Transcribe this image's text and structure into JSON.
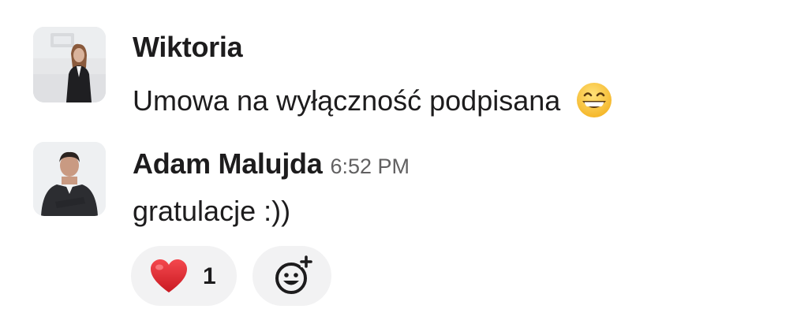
{
  "messages": [
    {
      "author": "Wiktoria",
      "time": "",
      "text": "Umowa na wyłączność podpisana",
      "emoji": "grinning-squinting-face-icon"
    },
    {
      "author": "Adam Malujda",
      "time": "6:52 PM",
      "text": "gratulacje :))"
    }
  ],
  "reactions": [
    {
      "emoji": "red-heart-icon",
      "count": "1"
    }
  ],
  "add_reaction": {
    "icon": "add-reaction-icon"
  },
  "colors": {
    "text": "#1d1c1d",
    "timestamp": "#616061",
    "pill_bg": "#f2f2f3",
    "heart": "#e0262c"
  }
}
